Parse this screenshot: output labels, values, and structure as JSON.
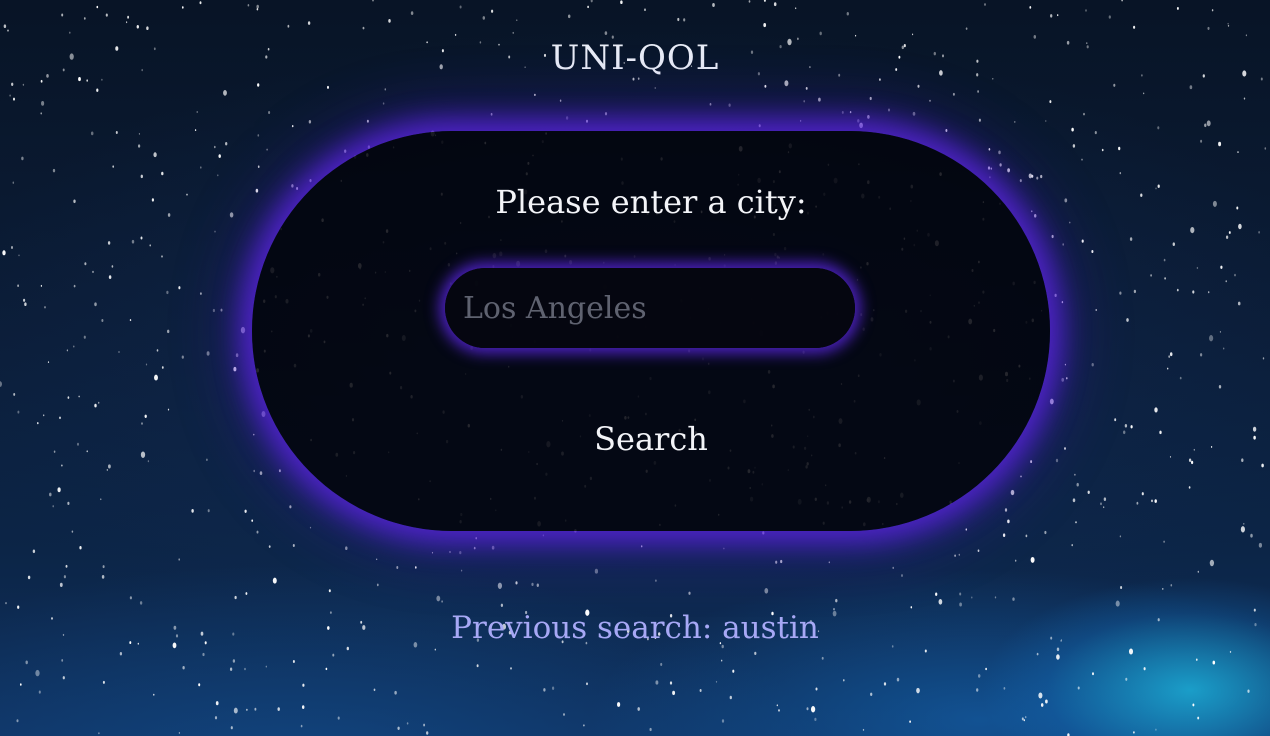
{
  "app": {
    "title": "UNI-QOL"
  },
  "search_card": {
    "prompt": "Please enter a city:",
    "input_placeholder": "Los Angeles",
    "input_value": "",
    "button_label": "Search"
  },
  "history": {
    "previous_search": "Previous search: austin"
  },
  "colors": {
    "glow": "#5624d6",
    "previous_search_text": "#a7a8f5",
    "card_background": "#02040c"
  }
}
